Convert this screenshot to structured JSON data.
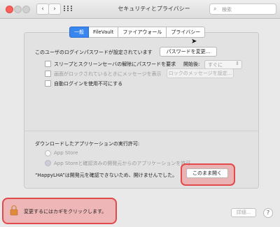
{
  "window": {
    "title": "セキュリティとプライバシー"
  },
  "search": {
    "placeholder": "検索"
  },
  "nav": {
    "back": "‹",
    "forward": "›"
  },
  "tabs": [
    "一般",
    "FileVault",
    "ファイアウォール",
    "プライバシー"
  ],
  "general": {
    "password_set_text": "このユーザのログインパスワードが設定されています",
    "change_password_button": "パスワードを変更...",
    "require_password_label": "スリープとスクリーンセーバの解除にパスワードを要求",
    "start_time_label": "開始後:",
    "start_time_value": "すぐに",
    "show_message_label": "画面がロックされているときにメッセージを表示",
    "set_lock_message_button": "ロックのメッセージを設定...",
    "disable_auto_login_label": "自動ログインを使用不可にする"
  },
  "downloads": {
    "heading": "ダウンロードしたアプリケーションの実行許可:",
    "option_app_store": "App Store",
    "option_app_store_identified": "App Storeと確認済みの開発元からのアプリケーションを許可",
    "blocked_message": "“HappyLHA”は開発元を確認できないため、開けませんでした。",
    "open_anyway_button": "このまま開く"
  },
  "footer": {
    "lock_text": "変更するにはカギをクリックします。",
    "advanced_button": "詳細...",
    "help_button": "?"
  },
  "colors": {
    "accent": "#3a86f0",
    "highlight": "#e04a4a",
    "close": "#fc605b"
  }
}
